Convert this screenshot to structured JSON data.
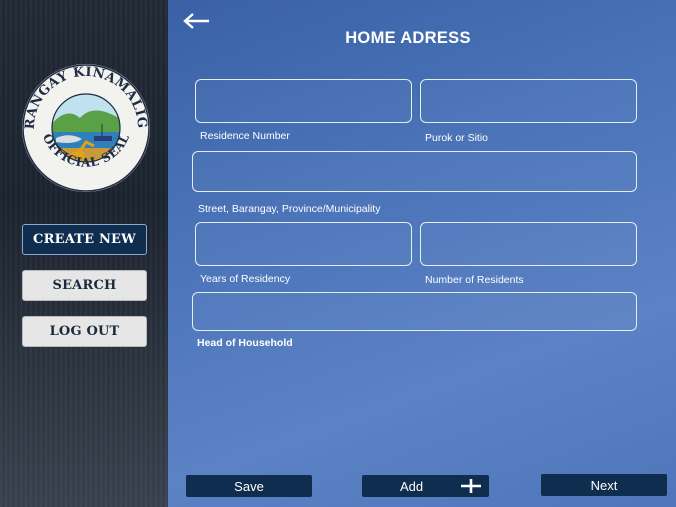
{
  "sidebar": {
    "seal": {
      "top_text": "BARANGAY KINAMALIGAN",
      "bottom_text": "OFFICIAL SEAL",
      "colors": {
        "ring": "#f2f2ee",
        "text": "#1f2a44",
        "accent": "#1e7b6b"
      }
    },
    "buttons": [
      {
        "label": "CREATE NEW",
        "style": "dark"
      },
      {
        "label": "SEARCH",
        "style": "light"
      },
      {
        "label": "LOG OUT",
        "style": "light"
      }
    ]
  },
  "header": {
    "back_icon": "arrow-left-icon",
    "title": "HOME ADRESS"
  },
  "form": {
    "residence_number_label": "Residence Number",
    "purok_label": "Purok or Sitio",
    "street_label": "Street, Barangay, Province/Municipality",
    "years_label": "Years of Residency",
    "residents_label": "Number of Residents",
    "head_label": "Head of Household"
  },
  "footer": {
    "save_label": "Save",
    "add_label": "Add",
    "add_icon": "plus-icon",
    "next_label": "Next"
  },
  "colors": {
    "sidebar_bg": "#1f2733",
    "main_bg": "#4a73b8",
    "button_dark": "#0f2d4e",
    "button_light": "#e6e6e6"
  }
}
